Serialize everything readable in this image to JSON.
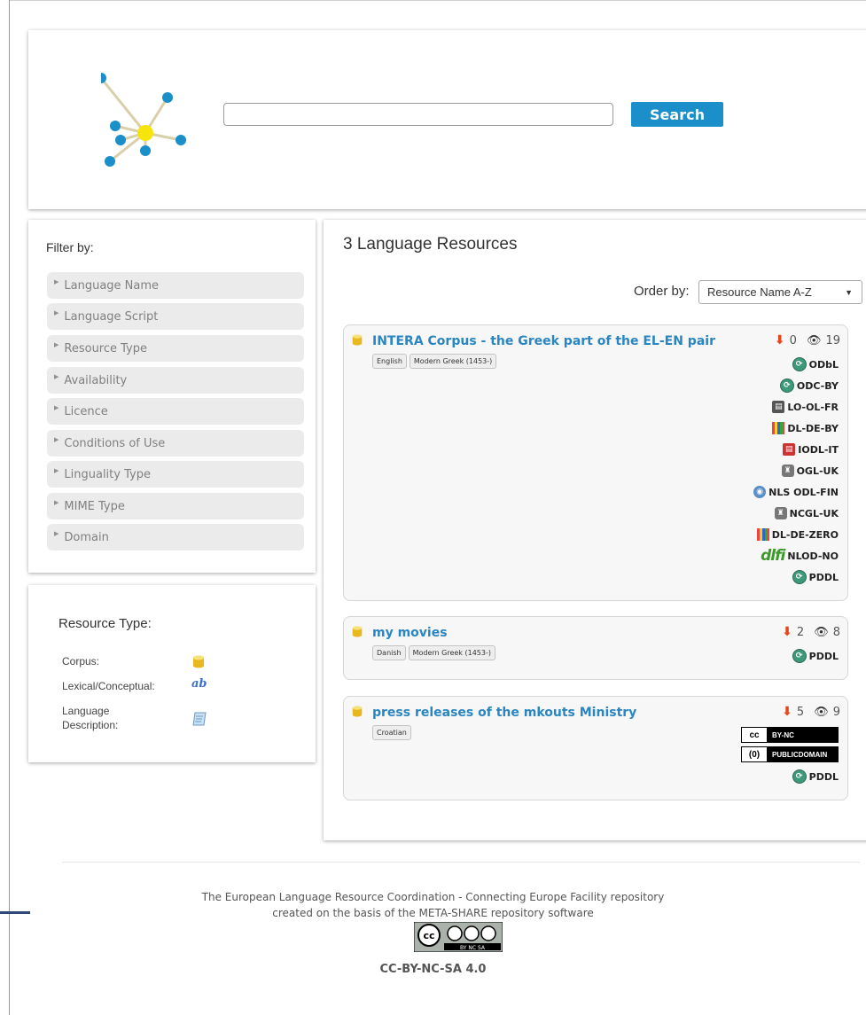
{
  "search": {
    "placeholder": "",
    "button_label": "Search"
  },
  "filters": {
    "title": "Filter by:",
    "items": [
      "Language Name",
      "Language Script",
      "Resource Type",
      "Availability",
      "Licence",
      "Conditions of Use",
      "Linguality Type",
      "MIME Type",
      "Domain"
    ]
  },
  "legend": {
    "title": "Resource Type:",
    "items": [
      {
        "label": "Corpus:",
        "icon": "corpus-icon"
      },
      {
        "label": "Lexical/Conceptual:",
        "icon": "lexical-icon",
        "icon_text": "ab"
      },
      {
        "label": "Language Description:",
        "icon": "description-icon"
      }
    ]
  },
  "results": {
    "title": "3 Language Resources",
    "order_label": "Order by:",
    "order_value": "Resource Name A-Z",
    "items": [
      {
        "title": "INTERA Corpus - the Greek part of the EL-EN pair",
        "languages": [
          "English",
          "Modern Greek (1453-)"
        ],
        "downloads": "0",
        "views": "19",
        "licences": [
          "ODbL",
          "ODC-BY",
          "LO-OL-FR",
          "DL-DE-BY",
          "IODL-IT",
          "OGL-UK",
          "NLS ODL-FIN",
          "NCGL-UK",
          "DL-DE-ZERO",
          "NLOD-NO",
          "PDDL"
        ],
        "licence_icons": [
          "green",
          "green",
          "sq-gray",
          "grid",
          "red",
          "gray",
          "globe",
          "gray",
          "grid",
          "dlfi",
          "green"
        ],
        "dlfi_text": "dlfi"
      },
      {
        "title": "my movies",
        "languages": [
          "Danish",
          "Modern Greek (1453-)"
        ],
        "downloads": "2",
        "views": "8",
        "licences": [
          "PDDL"
        ]
      },
      {
        "title": "press releases of the mkouts Ministry",
        "languages": [
          "Croatian"
        ],
        "downloads": "5",
        "views": "9",
        "cc_badges": [
          {
            "left": "cc",
            "right": "BY-NC"
          },
          {
            "left": "(0)",
            "right": "PUBLICDOMAIN"
          }
        ],
        "licences": [
          "PDDL"
        ]
      }
    ]
  },
  "footer": {
    "line1": "The European Language Resource Coordination - Connecting Europe Facility repository",
    "line2": "created on the basis of the META-SHARE repository software",
    "license": "CC-BY-NC-SA 4.0",
    "cc_badge_text": "BY NC SA"
  },
  "colors": {
    "accent": "#1a8fc9",
    "link": "#2a86c2",
    "download": "#e2481b",
    "logo_node": "#1a8fc9",
    "logo_center": "#f5e50a"
  }
}
